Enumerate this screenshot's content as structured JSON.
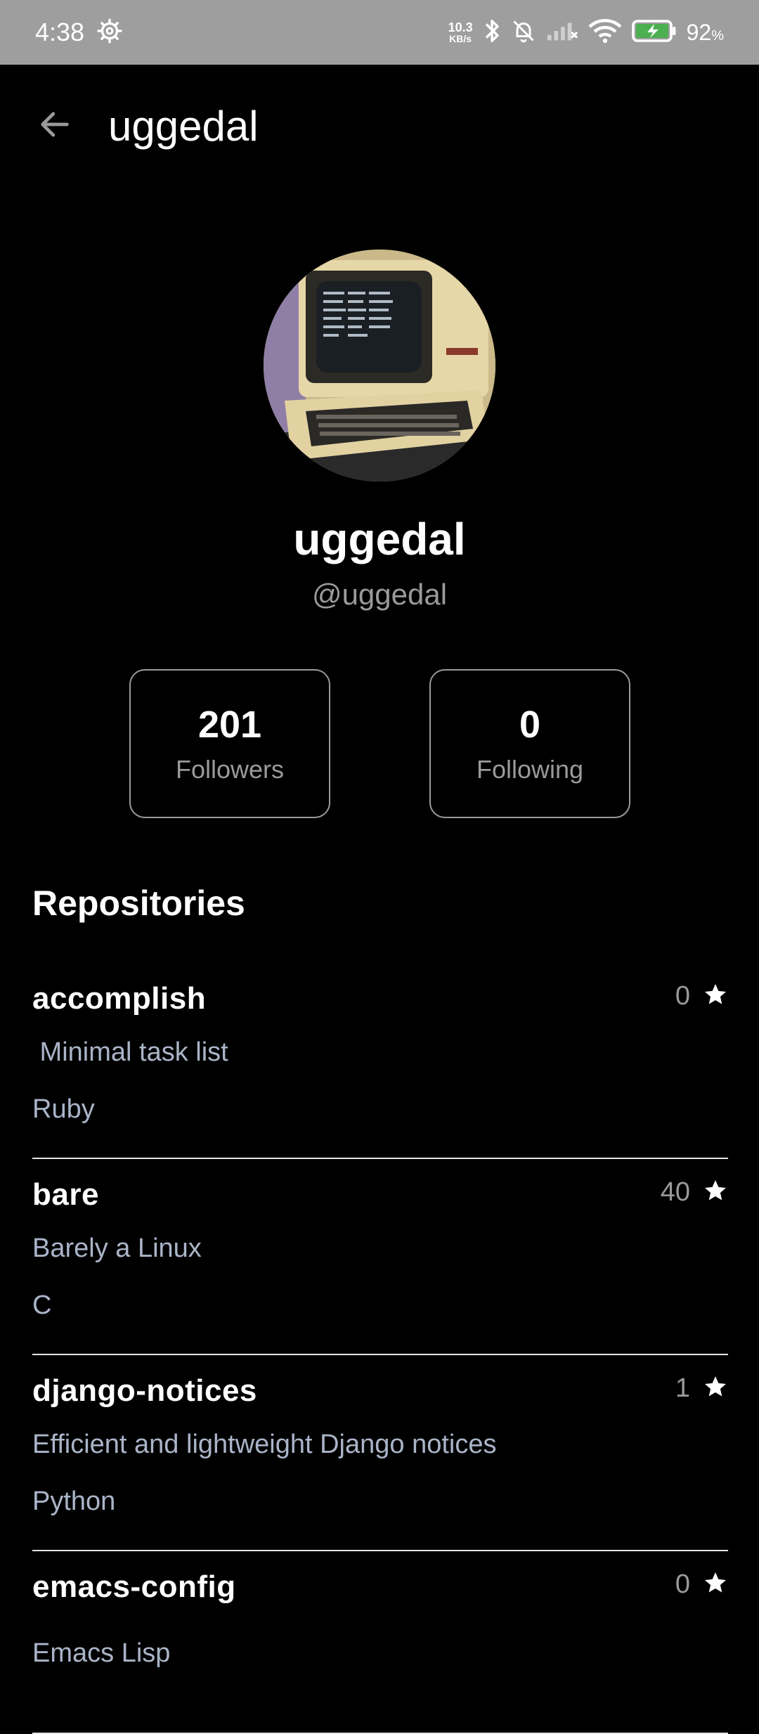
{
  "status_bar": {
    "time": "4:38",
    "net_speed_value": "10.3",
    "net_speed_unit": "KB/s",
    "battery_percent": "92",
    "battery_suffix": "%"
  },
  "app_bar": {
    "title": "uggedal"
  },
  "profile": {
    "name": "uggedal",
    "handle": "@uggedal",
    "followers": {
      "count": "201",
      "label": "Followers"
    },
    "following": {
      "count": "0",
      "label": "Following"
    }
  },
  "repositories": {
    "title": "Repositories",
    "items": [
      {
        "name": "accomplish",
        "stars": "0",
        "description": " Minimal task list",
        "language": "Ruby"
      },
      {
        "name": "bare",
        "stars": "40",
        "description": "Barely a Linux",
        "language": "C"
      },
      {
        "name": "django-notices",
        "stars": "1",
        "description": "Efficient and lightweight Django notices",
        "language": "Python"
      },
      {
        "name": "emacs-config",
        "stars": "0",
        "description": "",
        "language": "Emacs Lisp"
      }
    ]
  },
  "icons": {
    "settings": "gear-icon",
    "bluetooth": "bluetooth-icon",
    "notifications_off": "bell-off-icon",
    "signal": "signal-icon",
    "wifi": "wifi-icon",
    "battery": "battery-charging-icon",
    "back": "arrow-left-icon",
    "star": "star-icon"
  },
  "colors": {
    "background": "#000000",
    "status_bar": "#9e9e9e",
    "muted_text": "#9a9a9a",
    "secondary_text": "#aab4c8",
    "divider": "#e6e6e6"
  }
}
